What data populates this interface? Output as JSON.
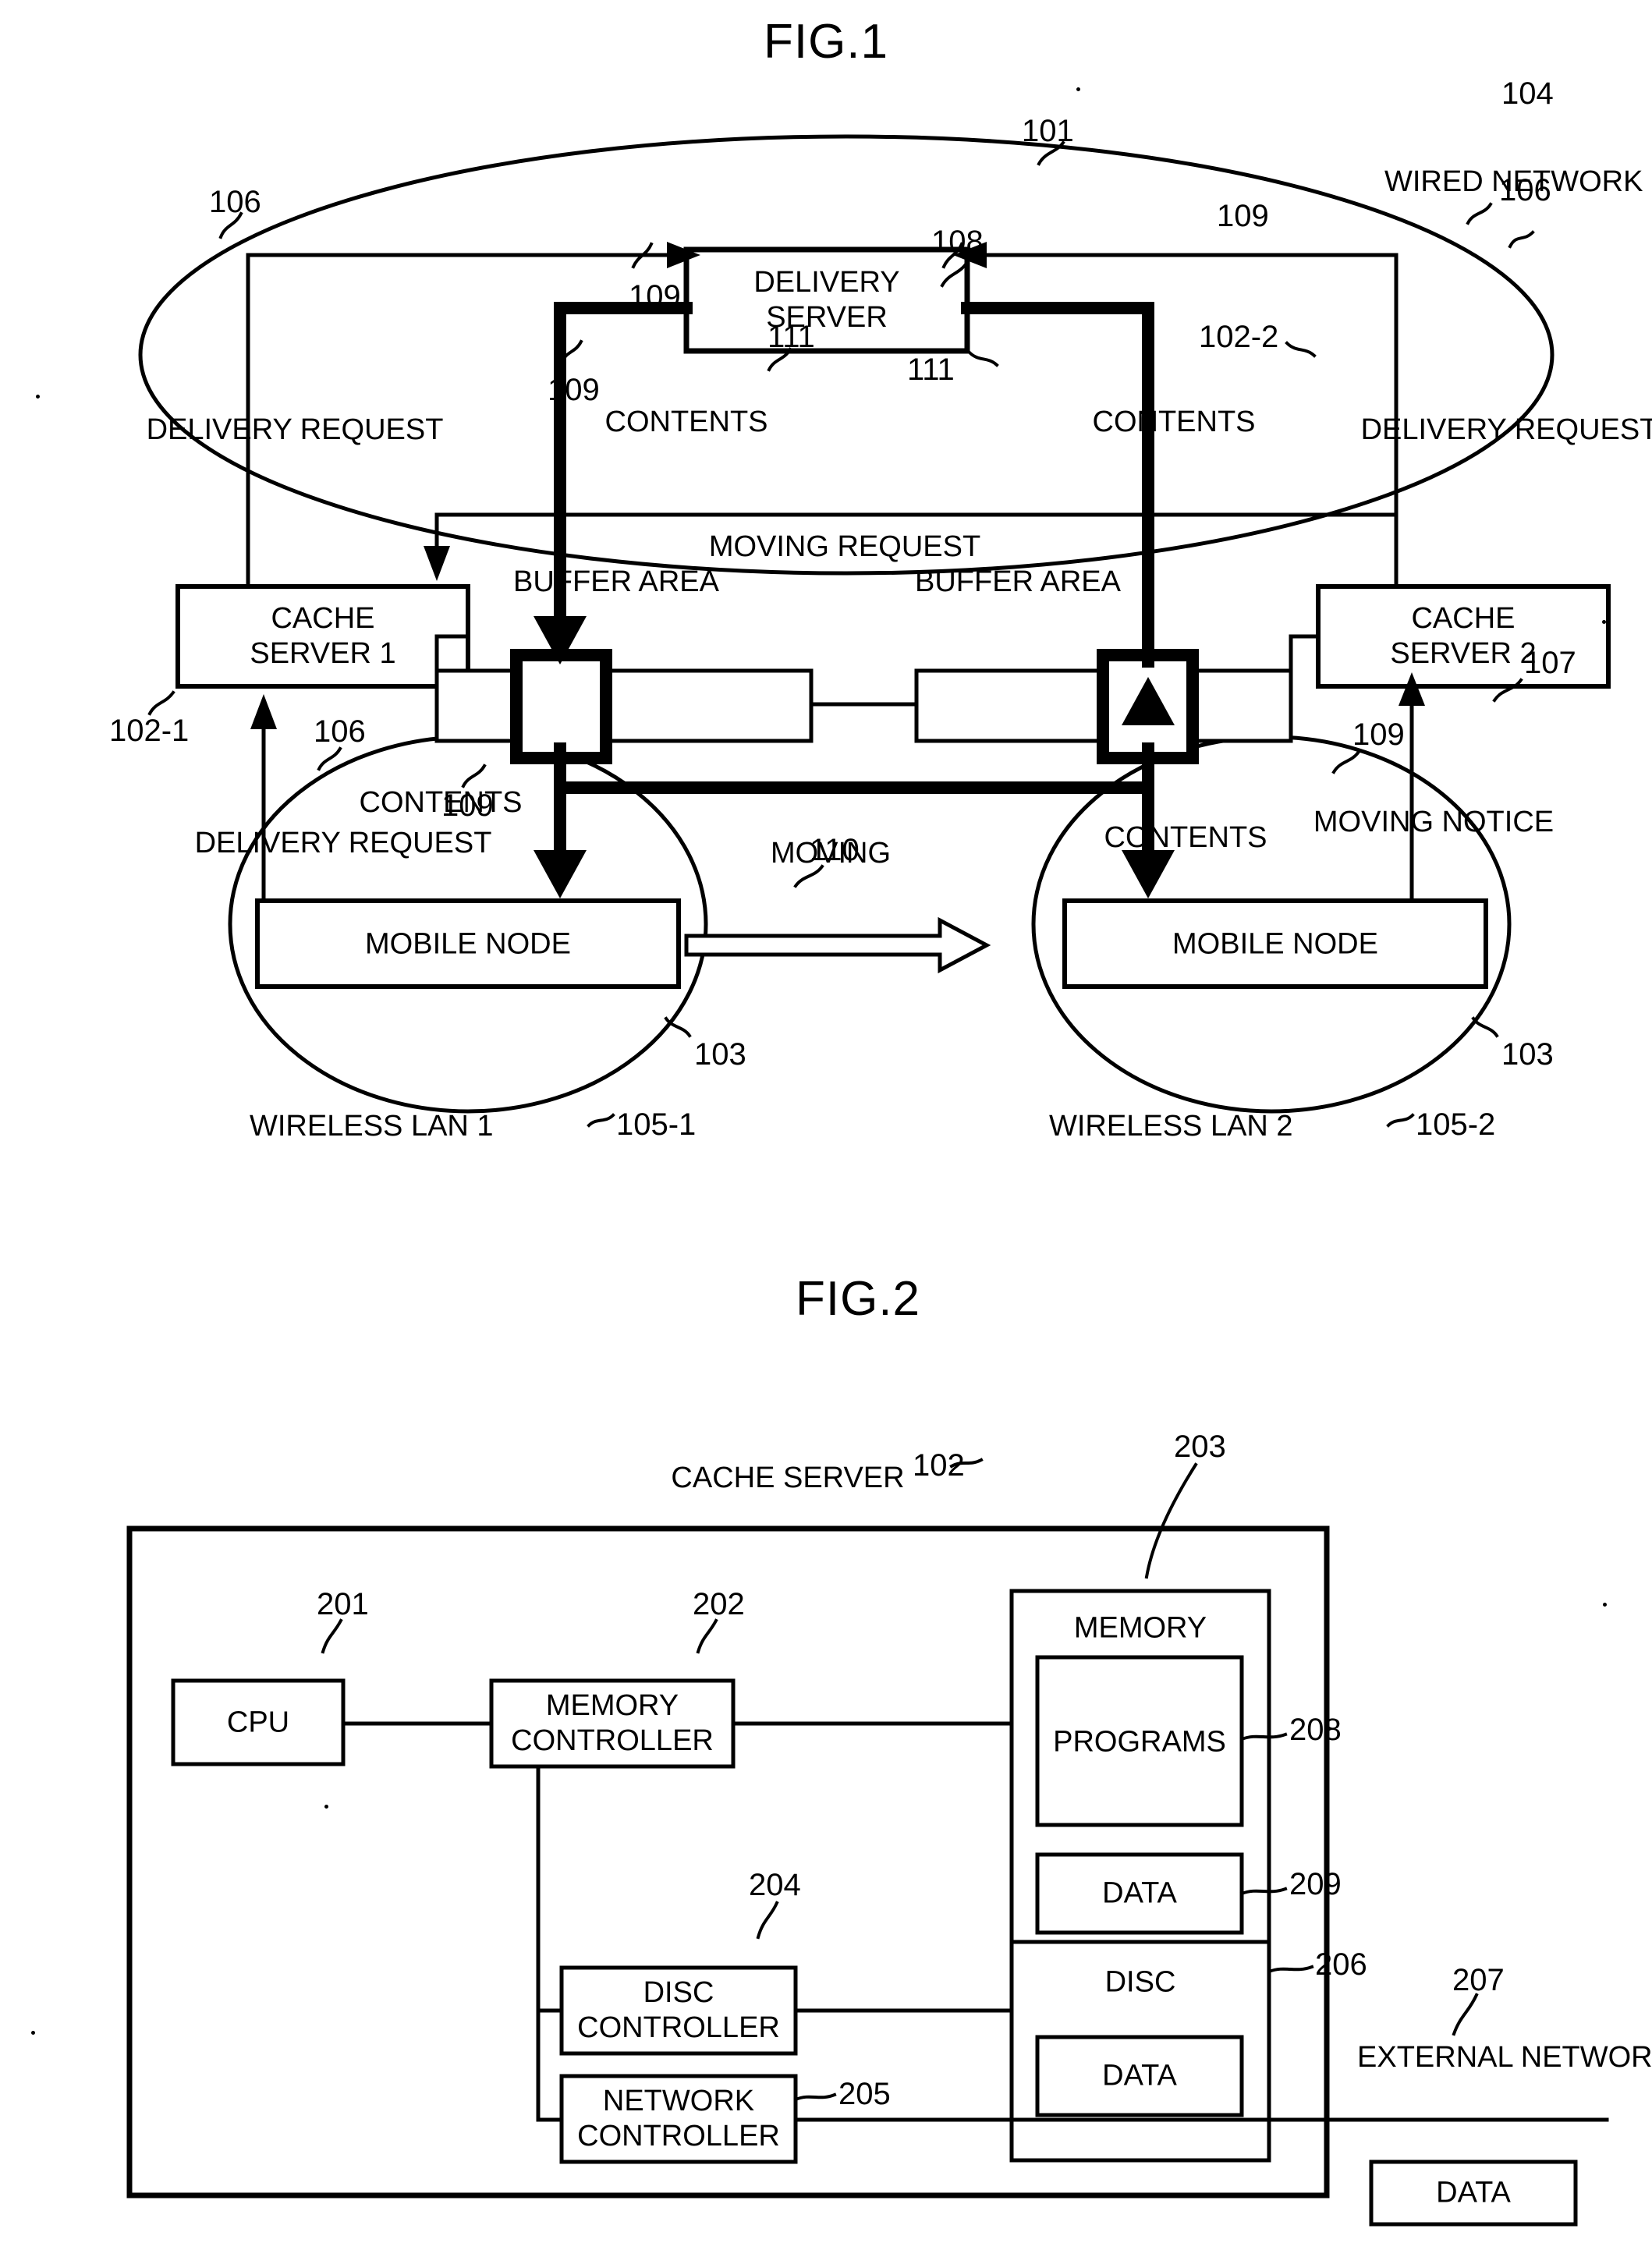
{
  "figures": [
    {
      "id": "fig1",
      "title": "FIG.1",
      "nodes": {
        "delivery_server": "DELIVERY\nSERVER",
        "cache_server_1": "CACHE\nSERVER 1",
        "cache_server_2": "CACHE\nSERVER 2",
        "mobile_node_left": "MOBILE NODE",
        "mobile_node_right": "MOBILE NODE"
      },
      "labels": {
        "wired_network": "WIRED\nNETWORK",
        "delivery_request_top_left": "DELIVERY\nREQUEST",
        "delivery_request_top_right": "DELIVERY\nREQUEST",
        "delivery_request_bottom_left": "DELIVERY\nREQUEST",
        "contents_left_top": "CONTENTS",
        "contents_right_top": "CONTENTS",
        "contents_bottom_left": "CONTENTS",
        "contents_bottom_right": "CONTENTS",
        "moving_request": "MOVING REQUEST",
        "buffer_area_left": "BUFFER\nAREA",
        "buffer_area_right": "BUFFER\nAREA",
        "moving": "MOVING",
        "moving_notice": "MOVING\nNOTICE",
        "wireless_lan_1": "WIRELESS LAN 1",
        "wireless_lan_2": "WIRELESS LAN 2"
      },
      "refnums": {
        "n101": "101",
        "n102_1": "102-1",
        "n102_2": "102-2",
        "n103_left": "103",
        "n103_right": "103",
        "n104": "104",
        "n105_1": "105-1",
        "n105_2": "105-2",
        "n106_topleft": "106",
        "n106_topright": "106",
        "n106_bottomleft": "106",
        "n107": "107",
        "n108": "108",
        "n109_leftupper": "109",
        "n109_leftlower": "109",
        "n109_righttop": "109",
        "n109_bottomleft": "109",
        "n109_bottomright": "109",
        "n110": "110",
        "n111_left": "111",
        "n111_right": "111"
      }
    },
    {
      "id": "fig2",
      "title": "FIG.2",
      "nodes": {
        "cache_server": "CACHE SERVER",
        "cpu": "CPU",
        "memory_controller": "MEMORY\nCONTROLLER",
        "memory": "MEMORY",
        "programs": "PROGRAMS",
        "memory_data": "DATA",
        "disc_controller": "DISC\nCONTROLLER",
        "network_controller": "NETWORK\nCONTROLLER",
        "disc": "DISC",
        "disc_data": "DATA",
        "external_data": "DATA"
      },
      "labels": {
        "external_network_data": "EXTERNAL\nNETWORK DATA"
      },
      "refnums": {
        "n102": "102",
        "n201": "201",
        "n202": "202",
        "n203": "203",
        "n204": "204",
        "n205": "205",
        "n206": "206",
        "n207": "207",
        "n208": "208",
        "n209": "209"
      }
    }
  ],
  "colors": {
    "ink": "#000000",
    "paper": "#ffffff"
  }
}
